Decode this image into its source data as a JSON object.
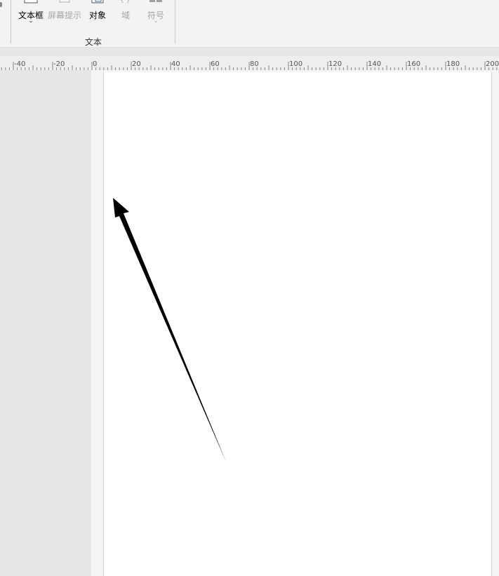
{
  "ribbon": {
    "buttons": [
      {
        "label": "文本框",
        "chevron": "⌄",
        "enabled": true
      },
      {
        "label": "屏幕提示",
        "enabled": false
      },
      {
        "label": "对象",
        "enabled": true
      },
      {
        "label": "域",
        "enabled": false
      },
      {
        "label": "符号",
        "chevron": "⌄",
        "enabled": false
      }
    ],
    "group_label": "文本"
  },
  "ruler": {
    "labels": [
      "-40",
      "-20",
      "0",
      "20",
      "40",
      "60",
      "80",
      "100",
      "120",
      "140",
      "160",
      "180",
      "200"
    ]
  },
  "colors": {
    "ribbon_bg": "#f3f3f3",
    "ruler_bg": "#eeeeee",
    "pasteboard": "#e6e6e6",
    "page": "#ffffff",
    "arrow": "#000000"
  }
}
